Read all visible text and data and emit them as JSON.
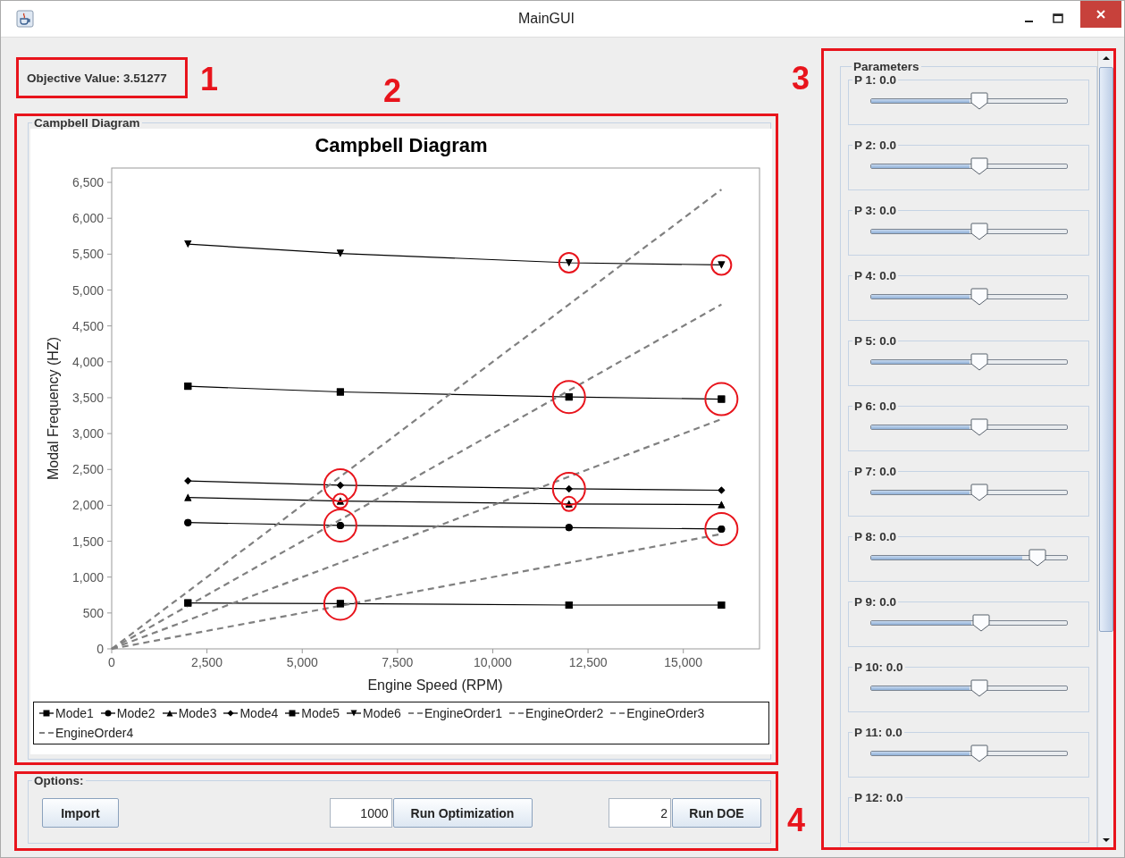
{
  "window": {
    "title": "MainGUI"
  },
  "objective": {
    "label": "Objective Value: 3.51277",
    "callout": "1"
  },
  "campbell_panel": {
    "border_title": "Campbell Diagram",
    "callout": "2",
    "chart_data": {
      "type": "line",
      "title": "Campbell Diagram",
      "xlabel": "Engine Speed (RPM)",
      "ylabel": "Modal Frequency (HZ)",
      "x": [
        0,
        2000,
        6000,
        12000,
        16000
      ],
      "series": [
        {
          "name": "Mode1",
          "color": "#000000",
          "marker": "square",
          "line_style": "solid",
          "values": [
            null,
            640,
            630,
            610,
            610
          ]
        },
        {
          "name": "Mode2",
          "color": "#000000",
          "marker": "circle",
          "line_style": "solid",
          "values": [
            null,
            1760,
            1720,
            1690,
            1670
          ]
        },
        {
          "name": "Mode3",
          "color": "#000000",
          "marker": "triangle-up",
          "line_style": "solid",
          "values": [
            null,
            2110,
            2060,
            2020,
            2010
          ]
        },
        {
          "name": "Mode4",
          "color": "#000000",
          "marker": "diamond",
          "line_style": "solid",
          "values": [
            null,
            2340,
            2280,
            2230,
            2210
          ]
        },
        {
          "name": "Mode5",
          "color": "#000000",
          "marker": "square",
          "line_style": "solid",
          "values": [
            null,
            3660,
            3580,
            3510,
            3480
          ]
        },
        {
          "name": "Mode6",
          "color": "#000000",
          "marker": "triangle-down",
          "line_style": "solid",
          "values": [
            null,
            5640,
            5510,
            5380,
            5350
          ]
        },
        {
          "name": "EngineOrder1",
          "color": "#808080",
          "marker": "none",
          "line_style": "dashed",
          "values": [
            0,
            800,
            2400,
            4800,
            6400
          ]
        },
        {
          "name": "EngineOrder2",
          "color": "#808080",
          "marker": "none",
          "line_style": "dashed",
          "values": [
            0,
            600,
            1800,
            3600,
            4800
          ]
        },
        {
          "name": "EngineOrder3",
          "color": "#808080",
          "marker": "none",
          "line_style": "dashed",
          "values": [
            0,
            400,
            1200,
            2400,
            3200
          ]
        },
        {
          "name": "EngineOrder4",
          "color": "#808080",
          "marker": "none",
          "line_style": "dashed",
          "values": [
            0,
            200,
            600,
            1200,
            1600
          ]
        }
      ],
      "xlim": [
        0,
        17000
      ],
      "ylim": [
        0,
        6700
      ],
      "xticks": [
        {
          "value": 0,
          "label": "0"
        },
        {
          "value": 2500,
          "label": "2,500"
        },
        {
          "value": 5000,
          "label": "5,000"
        },
        {
          "value": 7500,
          "label": "7,500"
        },
        {
          "value": 10000,
          "label": "10,000"
        },
        {
          "value": 12500,
          "label": "12,500"
        },
        {
          "value": 15000,
          "label": "15,000"
        }
      ],
      "yticks": [
        {
          "value": 0,
          "label": "0"
        },
        {
          "value": 500,
          "label": "500"
        },
        {
          "value": 1000,
          "label": "1,000"
        },
        {
          "value": 1500,
          "label": "1,500"
        },
        {
          "value": 2000,
          "label": "2,000"
        },
        {
          "value": 2500,
          "label": "2,500"
        },
        {
          "value": 3000,
          "label": "3,000"
        },
        {
          "value": 3500,
          "label": "3,500"
        },
        {
          "value": 4000,
          "label": "4,000"
        },
        {
          "value": 4500,
          "label": "4,500"
        },
        {
          "value": 5000,
          "label": "5,000"
        },
        {
          "value": 5500,
          "label": "5,500"
        },
        {
          "value": 6000,
          "label": "6,000"
        },
        {
          "value": 6500,
          "label": "6,500"
        }
      ]
    },
    "circled_points": [
      {
        "circled": [
          false,
          true,
          false,
          false
        ]
      },
      {
        "circled": [
          false,
          true,
          false,
          true
        ]
      },
      {
        "circled": [
          false,
          true,
          true,
          false
        ]
      },
      {
        "circled": [
          false,
          true,
          true,
          false
        ]
      },
      {
        "circled": [
          false,
          false,
          true,
          true
        ]
      },
      {
        "circled": [
          false,
          false,
          true,
          true
        ]
      }
    ]
  },
  "options": {
    "title": "Options:",
    "callout": "4",
    "import_button": "Import",
    "iterations": {
      "value": "1000"
    },
    "run_optimization_button": "Run Optimization",
    "doe_count": {
      "value": "2"
    },
    "run_doe_button": "Run DOE"
  },
  "parameters": {
    "title": "Parameters",
    "callout": "3",
    "sliders": [
      {
        "label": "P 1: 0.0",
        "level": 0.5
      },
      {
        "label": "P 2: 0.0",
        "level": 0.5
      },
      {
        "label": "P 3: 0.0",
        "level": 0.5
      },
      {
        "label": "P 4: 0.0",
        "level": 0.5
      },
      {
        "label": "P 5: 0.0",
        "level": 0.5
      },
      {
        "label": "P 6: 0.0",
        "level": 0.5
      },
      {
        "label": "P 7: 0.0",
        "level": 0.5
      },
      {
        "label": "P 8: 0.0",
        "level": 0.77
      },
      {
        "label": "P 9: 0.0",
        "level": 0.51
      },
      {
        "label": "P 10: 0.0",
        "level": 0.5
      },
      {
        "label": "P 11: 0.0",
        "level": 0.5
      },
      {
        "label": "P 12: 0.0"
      }
    ]
  }
}
